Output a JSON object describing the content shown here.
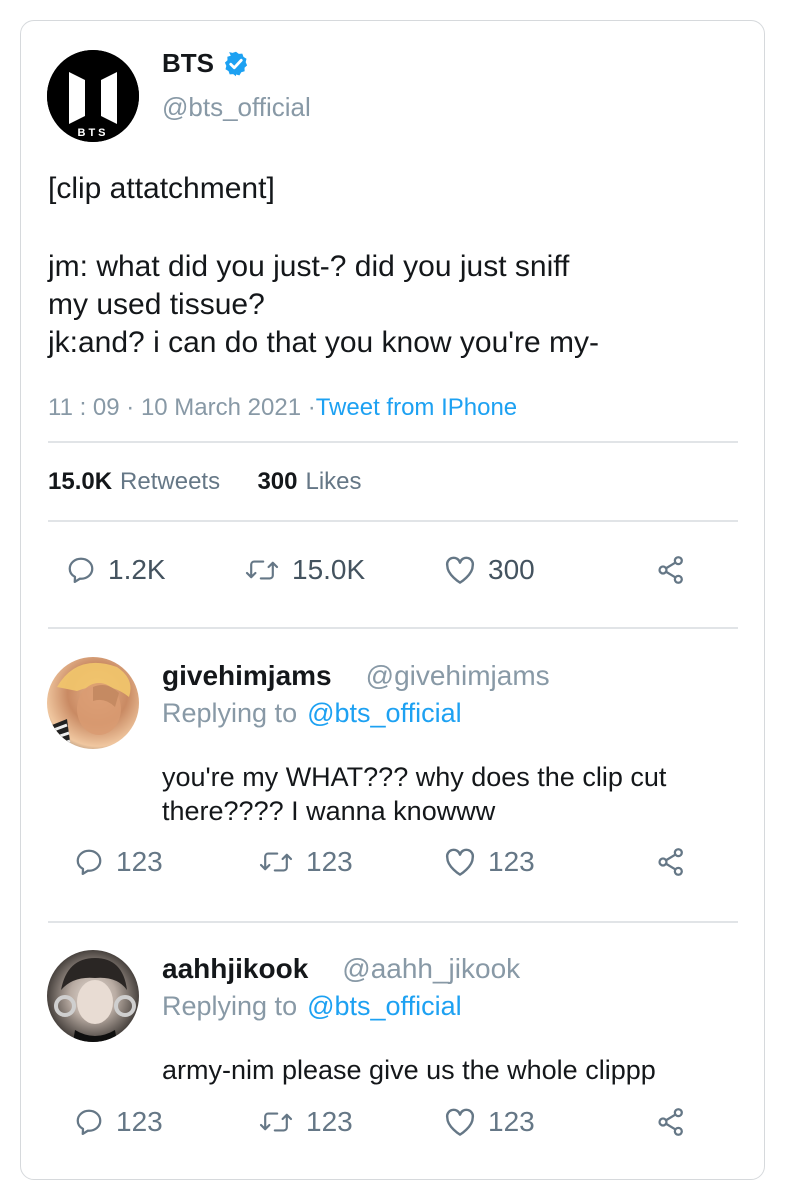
{
  "tweet": {
    "name": "BTS",
    "handle": "@bts_official",
    "avatar_text": "BTS",
    "text_line1": "[clip attatchment]",
    "text_line2": "jm: what did you just-? did you just sniff",
    "text_line3": "my used tissue?",
    "text_line4": "jk:and? i can do that you know you're my-",
    "time": "11 : 09 · 10 March 2021 ·",
    "source": "Tweet from IPhone",
    "retweets_count": "15.0K",
    "retweets_label": "Retweets",
    "likes_count": "300",
    "likes_label": "Likes",
    "actions": {
      "reply": "1.2K",
      "retweet": "15.0K",
      "like": "300"
    }
  },
  "replies": [
    {
      "name": "givehimjams",
      "handle": "@givehimjams",
      "replying_label": "Replying to",
      "replying_to": "@bts_official",
      "text": "you're my WHAT??? why does the clip cut there???? I wanna knowww",
      "actions": {
        "reply": "123",
        "retweet": "123",
        "like": "123"
      }
    },
    {
      "name": "aahhjikook",
      "handle": "@aahh_jikook",
      "replying_label": "Replying to",
      "replying_to": "@bts_official",
      "text": "army-nim please give us the whole clippp",
      "actions": {
        "reply": "123",
        "retweet": "123",
        "like": "123"
      }
    }
  ],
  "colors": {
    "link": "#1da1f2",
    "muted": "#8899a6",
    "text": "#14171a",
    "border": "#e1e4e7"
  },
  "icons": [
    "reply-icon",
    "retweet-icon",
    "like-icon",
    "share-icon",
    "verified-badge-icon"
  ]
}
